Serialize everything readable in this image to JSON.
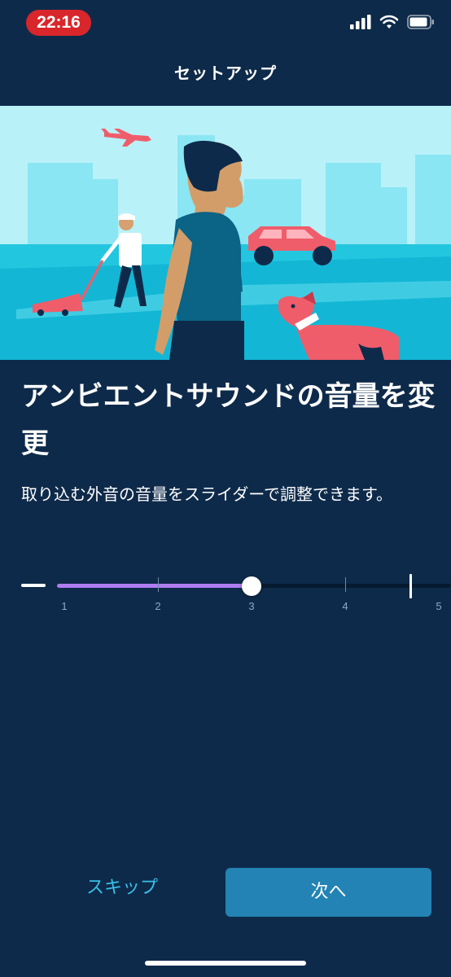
{
  "status_bar": {
    "time": "22:16",
    "icons": [
      "cellular-signal-icon",
      "wifi-icon",
      "battery-icon"
    ]
  },
  "nav": {
    "title": "セットアップ"
  },
  "hero": {
    "illustration": "person walking with dog, lawn mower, car, airplane"
  },
  "headline": "アンビエントサウンドの音量を変更",
  "description": "取り込む外音の音量をスライダーで調整できます。",
  "slider": {
    "value": 3,
    "min_label": "",
    "tick_labels": [
      "1",
      "2",
      "3",
      "4",
      "5"
    ],
    "fill_color": "#b07cf0"
  },
  "buttons": {
    "skip_label": "スキップ",
    "next_label": "次へ"
  },
  "colors": {
    "background": "#0e2a4a",
    "accent": "#38c0e8",
    "primary_button": "#2283b4",
    "status_time_bg": "#d8262b"
  }
}
